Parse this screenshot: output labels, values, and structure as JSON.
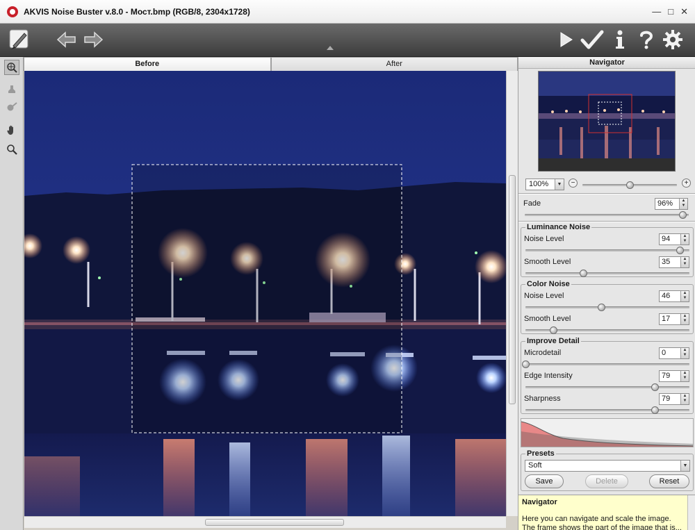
{
  "window": {
    "title": "AKVIS Noise Buster v.8.0 - Мост.bmp (RGB/8, 2304x1728)",
    "min_glyph": "—",
    "max_glyph": "□",
    "close_glyph": "✕"
  },
  "toolbar": {
    "icons": [
      "logo-brush-icon",
      "undo-arrow-icon",
      "redo-arrow-icon",
      "run-play-icon",
      "apply-check-icon",
      "info-icon",
      "help-icon",
      "settings-gear-icon"
    ]
  },
  "left_tools": [
    "view-selection-icon",
    "stamp-icon",
    "brush-icon",
    "hand-icon",
    "zoom-magnifier-icon"
  ],
  "tabs": [
    {
      "label": "Before",
      "active": true
    },
    {
      "label": "After",
      "active": false
    }
  ],
  "navigator": {
    "title": "Navigator",
    "zoom": "100%",
    "zoom_slider_level": 0.5
  },
  "fade": {
    "label": "Fade",
    "value": "96%",
    "level": 0.96
  },
  "luminance_noise": {
    "title": "Luminance Noise",
    "noise_level": {
      "label": "Noise Level",
      "value": "94",
      "level": 0.94
    },
    "smooth_level": {
      "label": "Smooth Level",
      "value": "35",
      "level": 0.35
    }
  },
  "color_noise": {
    "title": "Color Noise",
    "noise_level": {
      "label": "Noise Level",
      "value": "46",
      "level": 0.46
    },
    "smooth_level": {
      "label": "Smooth Level",
      "value": "17",
      "level": 0.17
    }
  },
  "improve_detail": {
    "title": "Improve Detail",
    "microdetail": {
      "label": "Microdetail",
      "value": "0",
      "level": 0.0
    },
    "edge_intensity": {
      "label": "Edge Intensity",
      "value": "79",
      "level": 0.79
    },
    "sharpness": {
      "label": "Sharpness",
      "value": "79",
      "level": 0.79
    }
  },
  "presets": {
    "title": "Presets",
    "selected": "Soft",
    "save_label": "Save",
    "delete_label": "Delete",
    "reset_label": "Reset"
  },
  "help": {
    "title": "Navigator",
    "text": "Here you can navigate and scale the image. The frame shows the part of the image that is..."
  },
  "colors": {
    "toolbar_bg": "#4a4a4a",
    "night_sky": "#1f2f7a",
    "help_bg": "#ffffcc"
  }
}
